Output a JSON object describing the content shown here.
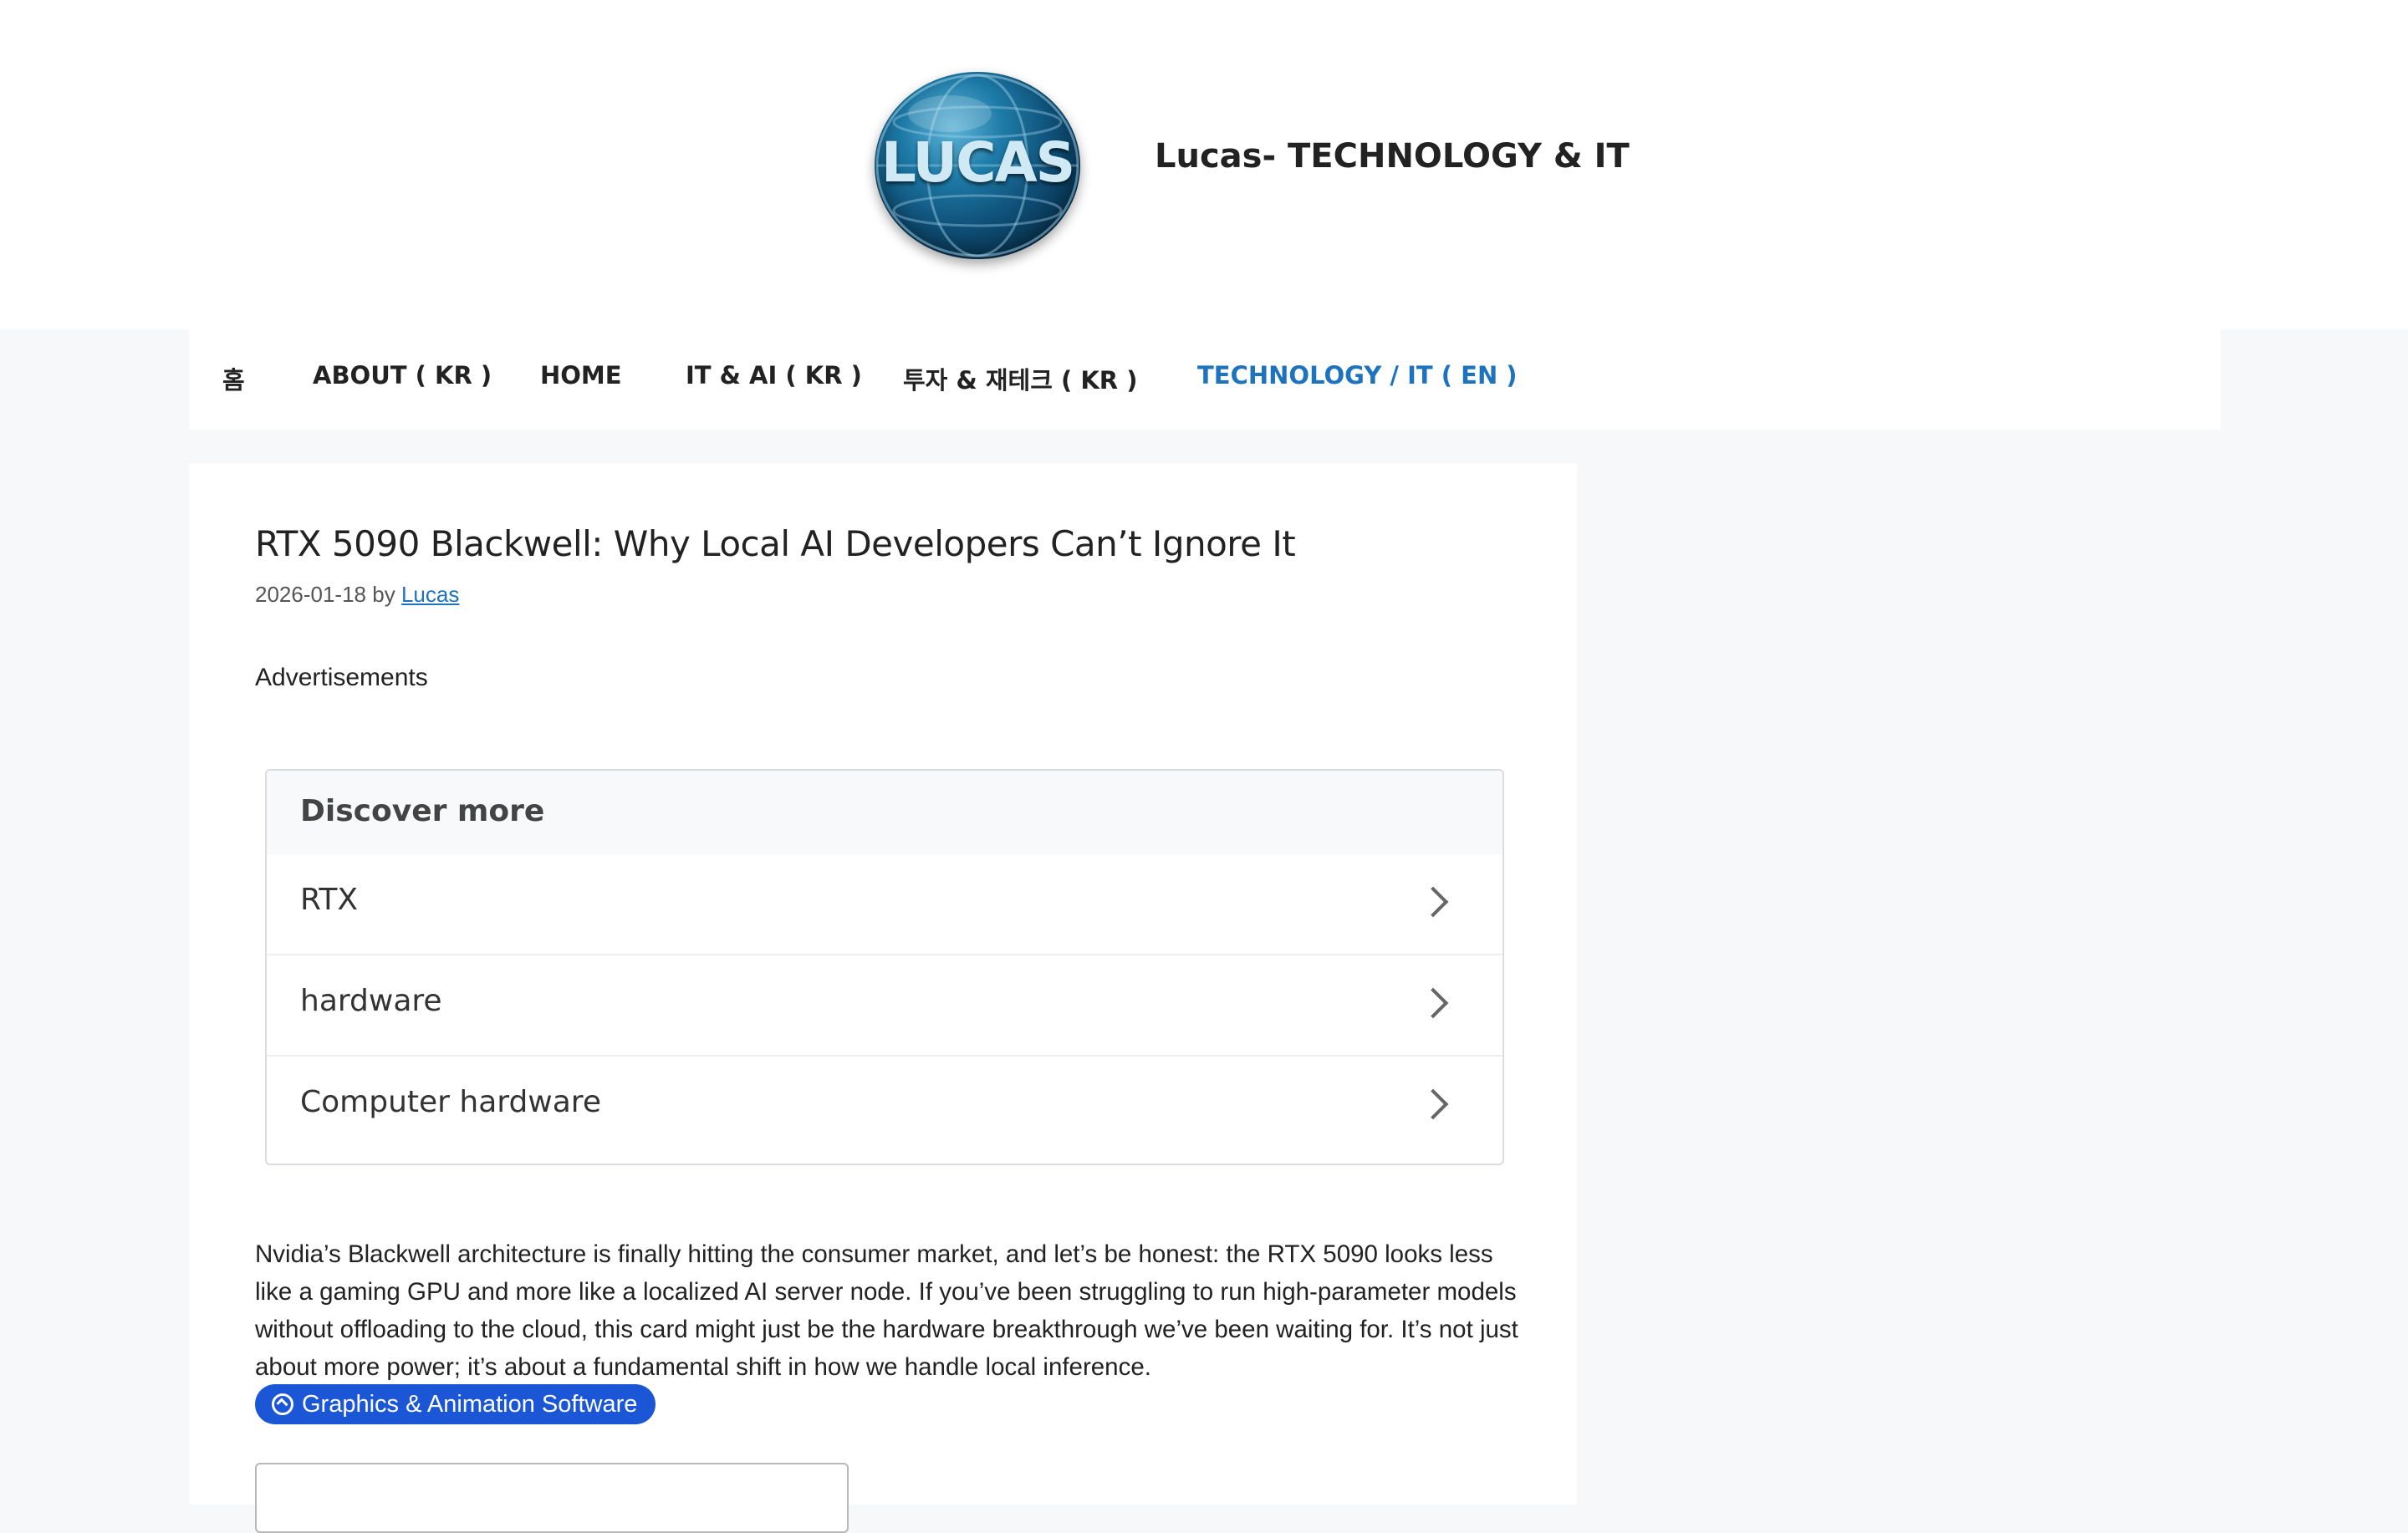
{
  "header": {
    "logo_text": "LUCAS",
    "site_title": "Lucas- TECHNOLOGY & IT"
  },
  "nav": {
    "items": [
      {
        "label": "홈"
      },
      {
        "label": "ABOUT ( KR )"
      },
      {
        "label": "HOME"
      },
      {
        "label": "IT & AI ( KR )"
      },
      {
        "label": "투자 & 재테크 ( KR )"
      },
      {
        "label": "TECHNOLOGY / IT ( EN )"
      }
    ],
    "active_index": 5,
    "active_color": "#1e73be"
  },
  "post": {
    "title": "RTX 5090 Blackwell: Why Local AI Developers Can’t Ignore It",
    "date": "2026-01-18",
    "by": "by",
    "author": "Lucas",
    "ads_label": "Advertisements",
    "body": "Nvidia’s Blackwell architecture is finally hitting the consumer market, and let’s be honest: the RTX 5090 looks less like a gaming GPU and more like a localized AI server node. If you’ve been struggling to run high-parameter models without offloading to the cloud, this card might just be the hardware breakthrough we’ve been waiting for. It’s not just about more power; it’s about a fundamental shift in how we handle local inference."
  },
  "discover": {
    "title": "Discover more",
    "items": [
      {
        "label": "RTX"
      },
      {
        "label": "hardware"
      },
      {
        "label": "Computer hardware"
      }
    ]
  },
  "chip": {
    "label": "Graphics & Animation Software",
    "color": "#1a56d6"
  }
}
